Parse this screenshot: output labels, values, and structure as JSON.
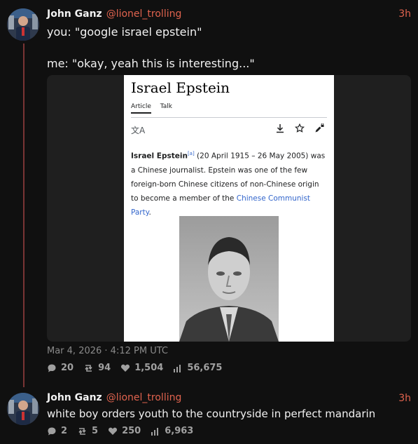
{
  "tweet1": {
    "name": "John Ganz",
    "handle": "@lionel_trolling",
    "time": "3h",
    "line1": "you: \"google israel epstein\"",
    "line2": "me: \"okay, yeah this is interesting...\"",
    "date": "Mar 4, 2026 · 4:12 PM UTC",
    "stats": {
      "replies": "20",
      "retweets": "94",
      "likes": "1,504",
      "views": "56,675"
    }
  },
  "wiki": {
    "title": "Israel Epstein",
    "tab_article": "Article",
    "tab_talk": "Talk",
    "lang_glyph": "文A",
    "body_name": "Israel Epstein",
    "body_ref": "[a]",
    "body_text1": " (20 April 1915 – 26 May 2005) was a Chinese journalist. Epstein was one of the few foreign-born Chinese citizens of non-Chinese origin to become a member of the ",
    "body_link": "Chinese Communist Party",
    "body_end": "."
  },
  "tweet2": {
    "name": "John Ganz",
    "handle": "@lionel_trolling",
    "time": "3h",
    "text": "white boy orders youth to the countryside in perfect mandarin",
    "stats": {
      "replies": "2",
      "retweets": "5",
      "likes": "250",
      "views": "6,963"
    }
  },
  "colors": {
    "accent": "#e0634e",
    "background": "#101010",
    "thread_line": "#7a3434",
    "link": "#3366cc"
  }
}
